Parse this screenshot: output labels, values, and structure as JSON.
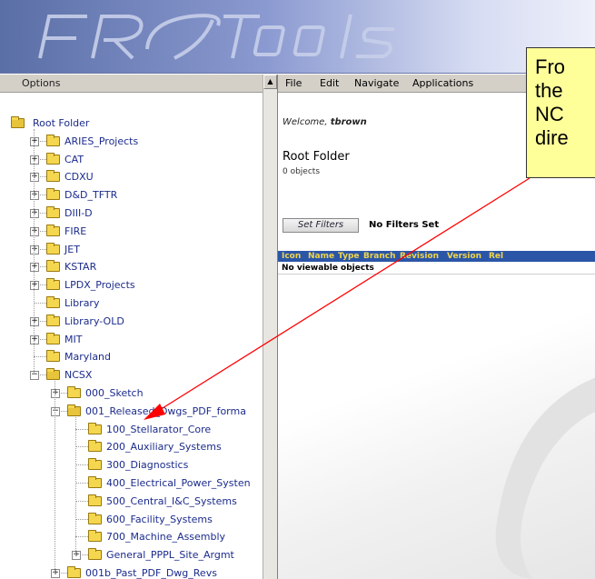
{
  "app": {
    "logo_text": "FR Tools"
  },
  "left_pane": {
    "header_label": "Options",
    "tree": [
      {
        "label": "Root Folder",
        "depth": 0,
        "expander": "none",
        "open": true
      },
      {
        "label": "ARIES_Projects",
        "depth": 1,
        "expander": "plus"
      },
      {
        "label": "CAT",
        "depth": 1,
        "expander": "plus"
      },
      {
        "label": "CDXU",
        "depth": 1,
        "expander": "plus"
      },
      {
        "label": "D&D_TFTR",
        "depth": 1,
        "expander": "plus"
      },
      {
        "label": "DIII-D",
        "depth": 1,
        "expander": "plus"
      },
      {
        "label": "FIRE",
        "depth": 1,
        "expander": "plus"
      },
      {
        "label": "JET",
        "depth": 1,
        "expander": "plus"
      },
      {
        "label": "KSTAR",
        "depth": 1,
        "expander": "plus"
      },
      {
        "label": "LPDX_Projects",
        "depth": 1,
        "expander": "plus"
      },
      {
        "label": "Library",
        "depth": 1,
        "expander": "none"
      },
      {
        "label": "Library-OLD",
        "depth": 1,
        "expander": "plus"
      },
      {
        "label": "MIT",
        "depth": 1,
        "expander": "plus"
      },
      {
        "label": "Maryland",
        "depth": 1,
        "expander": "none"
      },
      {
        "label": "NCSX",
        "depth": 1,
        "expander": "minus",
        "open": true
      },
      {
        "label": "000_Sketch",
        "depth": 2,
        "expander": "plus"
      },
      {
        "label": "001_Released_Dwgs_PDF_forma",
        "depth": 2,
        "expander": "minus",
        "open": true
      },
      {
        "label": "100_Stellarator_Core",
        "depth": 3,
        "expander": "none"
      },
      {
        "label": "200_Auxiliary_Systems",
        "depth": 3,
        "expander": "none"
      },
      {
        "label": "300_Diagnostics",
        "depth": 3,
        "expander": "none"
      },
      {
        "label": "400_Electrical_Power_Systen",
        "depth": 3,
        "expander": "none"
      },
      {
        "label": "500_Central_I&C_Systems",
        "depth": 3,
        "expander": "none"
      },
      {
        "label": "600_Facility_Systems",
        "depth": 3,
        "expander": "none"
      },
      {
        "label": "700_Machine_Assembly",
        "depth": 3,
        "expander": "none"
      },
      {
        "label": "General_PPPL_Site_Argmt",
        "depth": 3,
        "expander": "plus"
      },
      {
        "label": "001b_Past_PDF_Dwg_Revs",
        "depth": 2,
        "expander": "plus"
      }
    ]
  },
  "right_pane": {
    "menu": [
      "File",
      "Edit",
      "Navigate",
      "Applications"
    ],
    "welcome_prefix": "Welcome, ",
    "welcome_user": "tbrown",
    "page_title": "Root Folder",
    "object_count": "0 objects",
    "set_filters_label": "Set Filters",
    "filters_status": "No Filters Set",
    "table_columns": [
      "Icon",
      "Name",
      "Type",
      "Branch",
      "Revision",
      "Version",
      "Rel"
    ],
    "empty_message": "No viewable objects"
  },
  "callout": {
    "lines": [
      "Fro",
      "the",
      "NC",
      "dire"
    ]
  },
  "colors": {
    "banner_start": "#5a6fa6",
    "tree_text": "#1b2b8c",
    "folder": "#f4d74f",
    "table_header_bg": "#2b56a8",
    "table_header_text": "#f1d54a",
    "callout_bg": "#ffff99",
    "arrow": "#ff0000"
  }
}
